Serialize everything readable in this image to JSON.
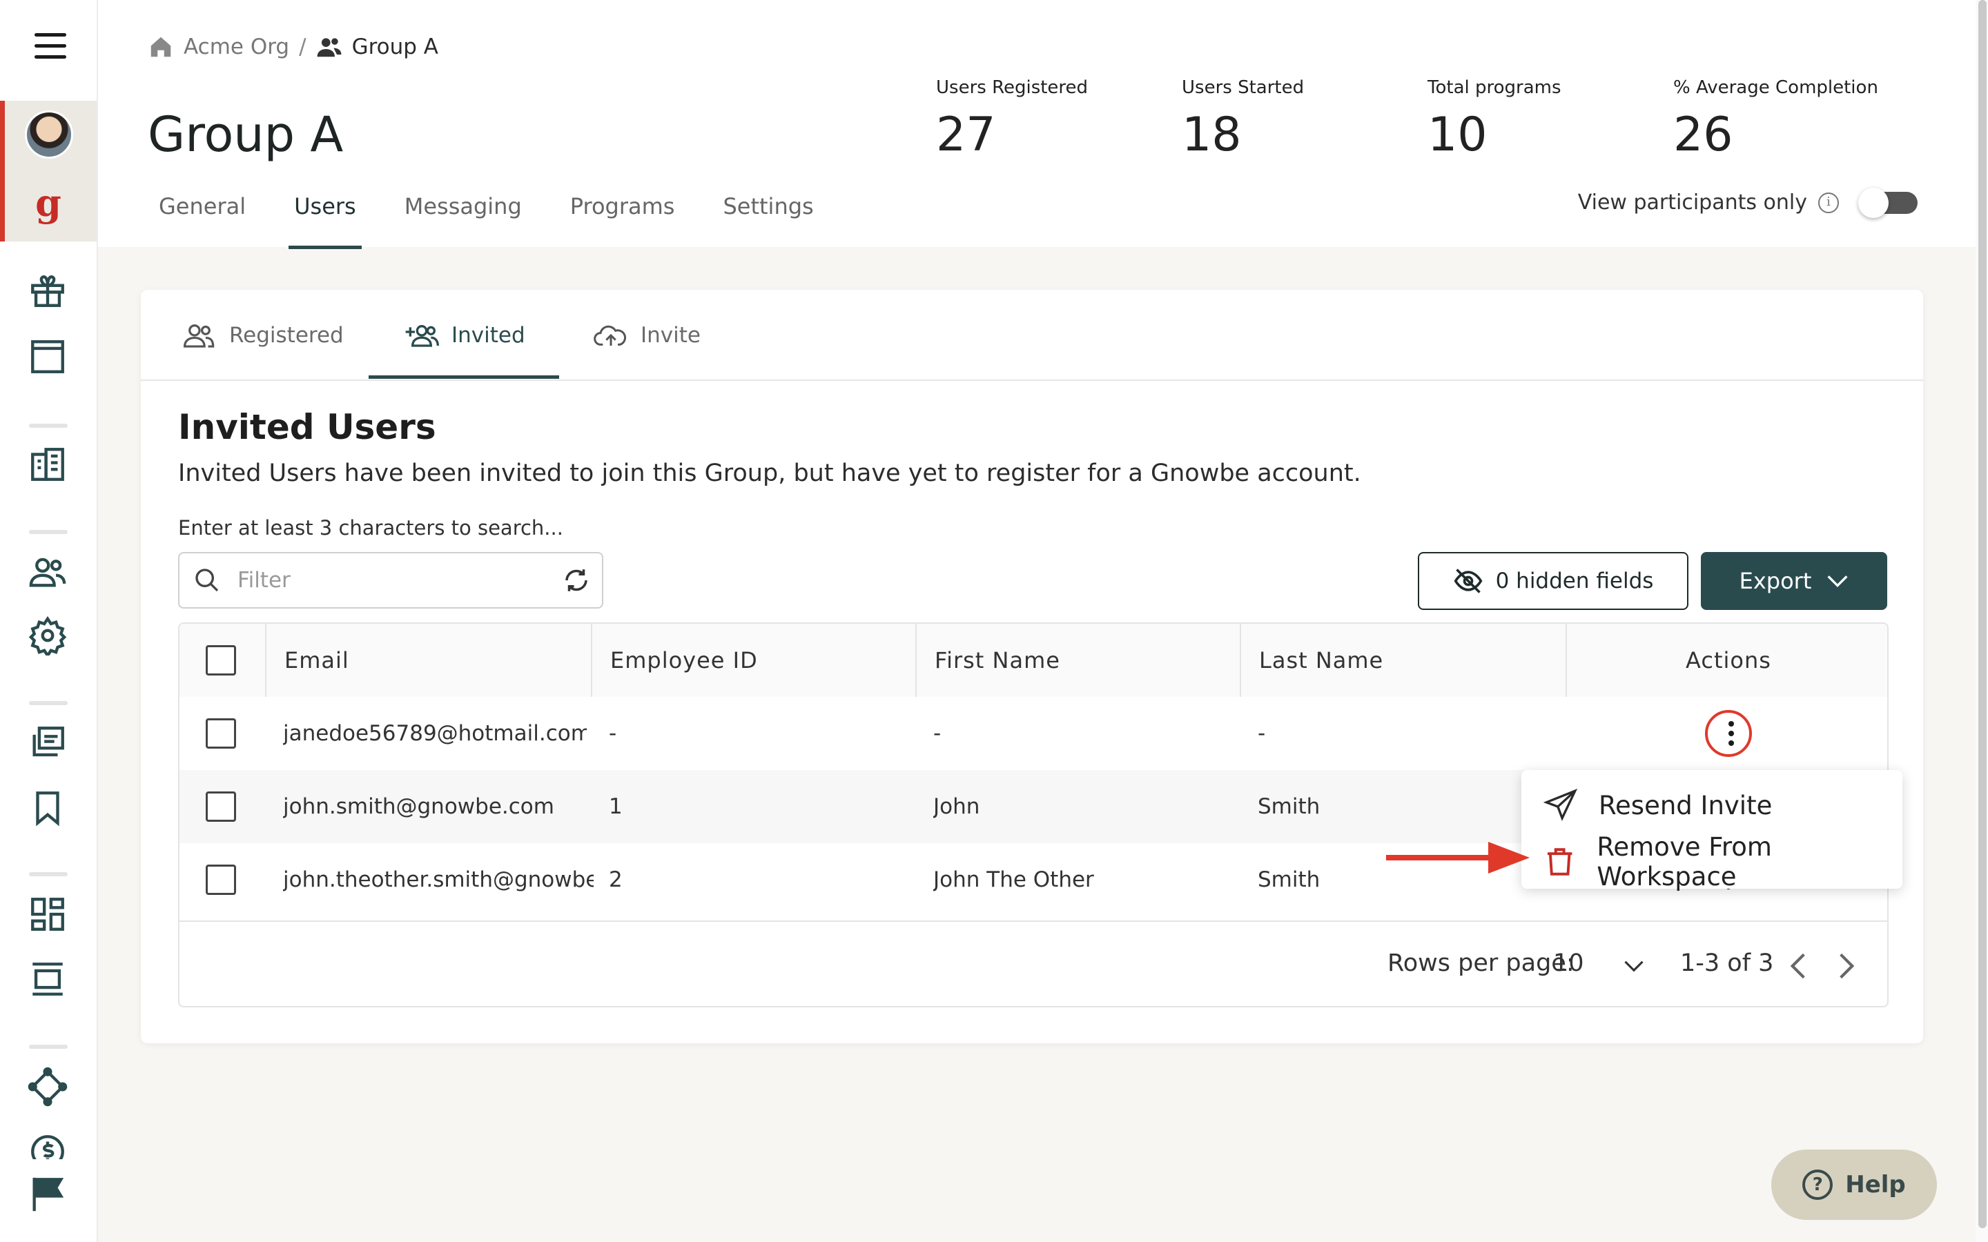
{
  "breadcrumb": {
    "org": "Acme Org",
    "separator": "/",
    "group": "Group A"
  },
  "page_title": "Group A",
  "stats": [
    {
      "label": "Users Registered",
      "value": "27"
    },
    {
      "label": "Users Started",
      "value": "18"
    },
    {
      "label": "Total programs",
      "value": "10"
    },
    {
      "label": "% Average Completion",
      "value": "26"
    }
  ],
  "tabs": [
    "General",
    "Users",
    "Messaging",
    "Programs",
    "Settings"
  ],
  "active_tab": "Users",
  "view_participants_only": {
    "label": "View participants only",
    "info": "i",
    "enabled": false
  },
  "subtabs": [
    "Registered",
    "Invited",
    "Invite"
  ],
  "active_subtab": "Invited",
  "section": {
    "title": "Invited Users",
    "description": "Invited Users have been invited to join this Group, but have yet to register for a Gnowbe account."
  },
  "search": {
    "hint": "Enter at least 3 characters to search...",
    "placeholder": "Filter",
    "value": ""
  },
  "hidden_fields_label": "0 hidden fields",
  "export_label": "Export",
  "table": {
    "columns": [
      "Email",
      "Employee ID",
      "First Name",
      "Last Name",
      "Actions"
    ],
    "rows": [
      {
        "email": "janedoe56789@hotmail.com",
        "employee_id": "-",
        "first_name": "-",
        "last_name": "-"
      },
      {
        "email": "john.smith@gnowbe.com",
        "employee_id": "1",
        "first_name": "John",
        "last_name": "Smith"
      },
      {
        "email": "john.theother.smith@gnowbe.com",
        "employee_id": "2",
        "first_name": "John The Other",
        "last_name": "Smith"
      }
    ]
  },
  "pagination": {
    "rows_per_page_label": "Rows per page:",
    "rows_per_page": "10",
    "range": "1-3 of 3"
  },
  "action_menu": {
    "resend": "Resend Invite",
    "remove": "Remove From Workspace"
  },
  "help_label": "Help",
  "colors": {
    "accent": "#2a4b4e",
    "highlight": "#e0392a",
    "brand_red": "#c62c26"
  }
}
